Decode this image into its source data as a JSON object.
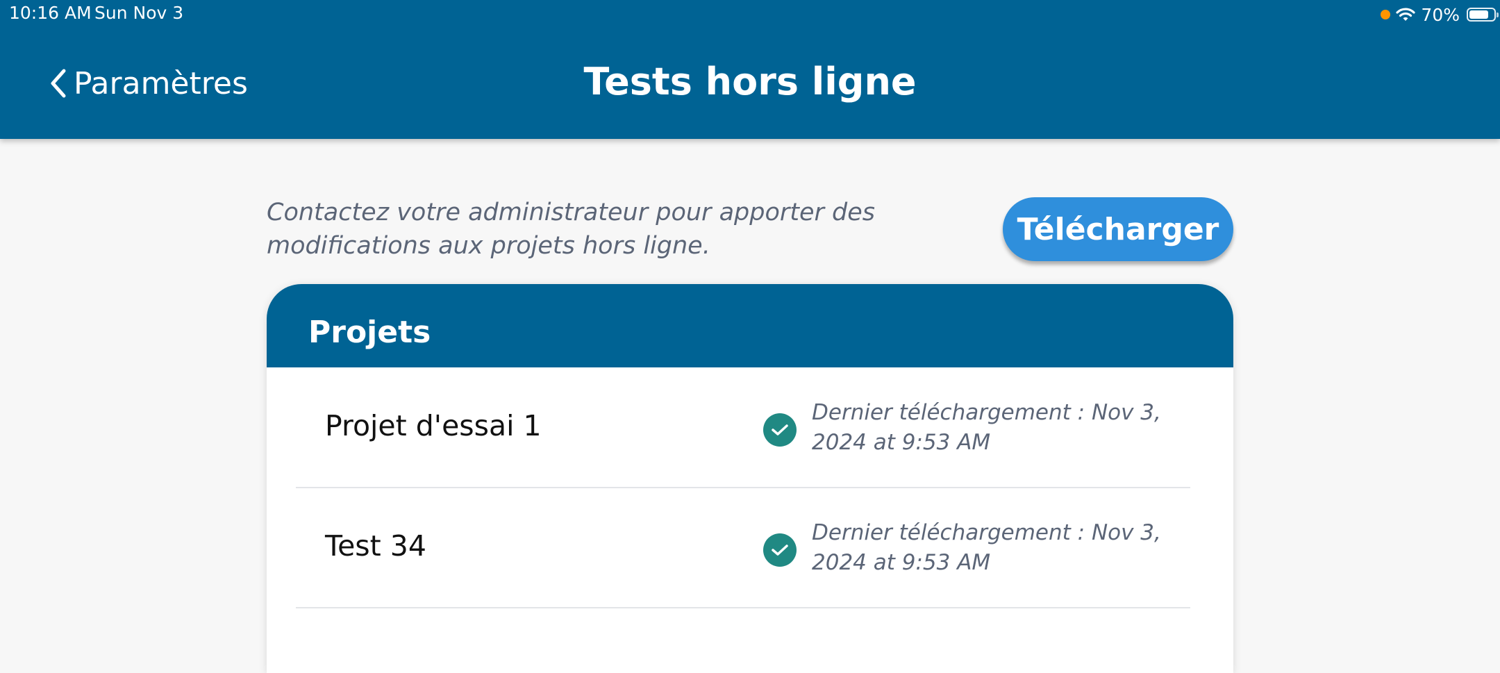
{
  "status_bar": {
    "time": "10:16 AM",
    "date": "Sun Nov 3",
    "battery": "70%",
    "icons": [
      "orange-dot",
      "wifi-icon",
      "battery-icon"
    ]
  },
  "nav": {
    "back_label": "Paramètres",
    "title": "Tests hors ligne"
  },
  "info_text": "Contactez votre administrateur pour apporter des modifications aux projets hors ligne.",
  "download_button": "Télécharger",
  "projects": {
    "header": "Projets",
    "items": [
      {
        "name": "Projet d'essai 1",
        "status_icon": "check-circle-icon",
        "last_download": "Dernier téléchargement : Nov 3, 2024 at 9:53 AM"
      },
      {
        "name": "Test 34",
        "status_icon": "check-circle-icon",
        "last_download": "Dernier téléchargement : Nov 3, 2024 at 9:53 AM"
      }
    ]
  },
  "colors": {
    "header_blue": "#006394",
    "button_blue": "#2f8fdc",
    "check_green": "#208983",
    "muted_text": "#5b6577"
  }
}
